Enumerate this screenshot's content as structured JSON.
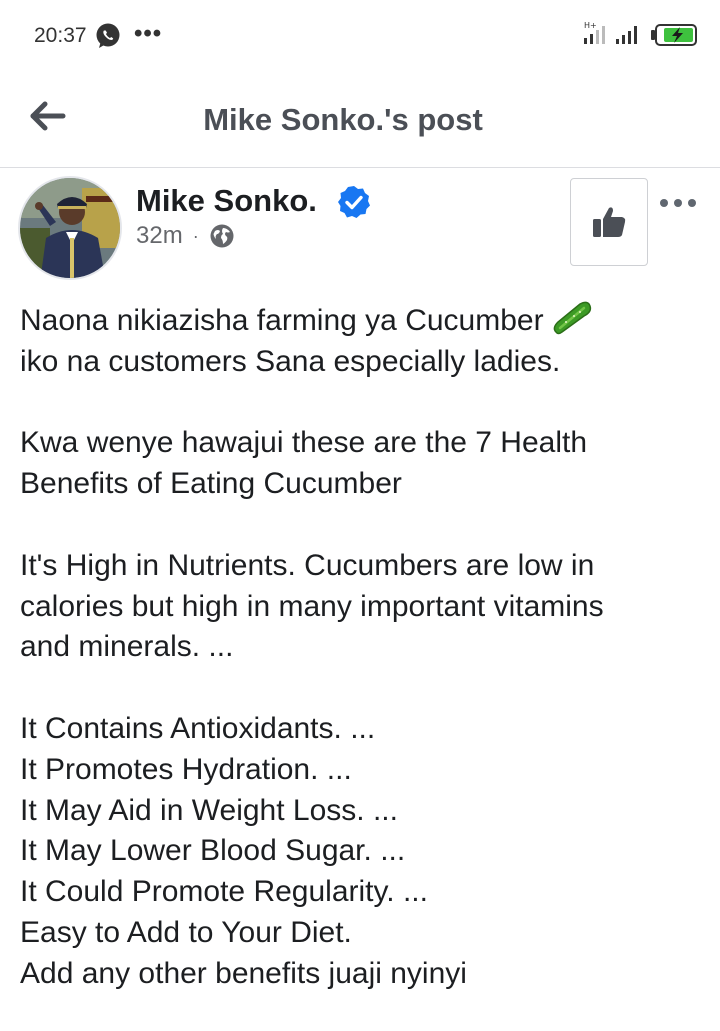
{
  "status_bar": {
    "time": "20:37",
    "more_icon": "•••",
    "icons": [
      "whatsapp-icon",
      "signal-icon",
      "signal-icon",
      "battery-charging-icon"
    ]
  },
  "header": {
    "title": "Mike Sonko.'s post"
  },
  "post": {
    "author": "Mike Sonko.",
    "time": "32m",
    "separator": "·",
    "privacy_icon": "globe-icon",
    "verified": true,
    "paragraphs": [
      [
        "Naona nikiazisha farming ya Cucumber",
        "iko na customers Sana especially ladies."
      ],
      [
        "Kwa wenye hawajui these are the 7 Health",
        "Benefits of Eating Cucumber"
      ],
      [
        "It's High in Nutrients. Cucumbers are low in",
        "calories but high in many important vitamins",
        "and minerals. ..."
      ],
      [
        "It Contains Antioxidants. ...",
        "It Promotes Hydration. ...",
        "It May Aid in Weight Loss. ...",
        "It May Lower Blood Sugar. ...",
        "It Could Promote Regularity. ...",
        "Easy to Add to Your Diet.",
        "Add any other benefits juaji nyinyi"
      ]
    ]
  },
  "colors": {
    "verified_blue": "#1877f2",
    "text_primary": "#1c1e21",
    "text_secondary": "#65676b",
    "header_text": "#4b4f56",
    "whatsapp": "#2b2b2b",
    "battery_green": "#3ec13e"
  }
}
